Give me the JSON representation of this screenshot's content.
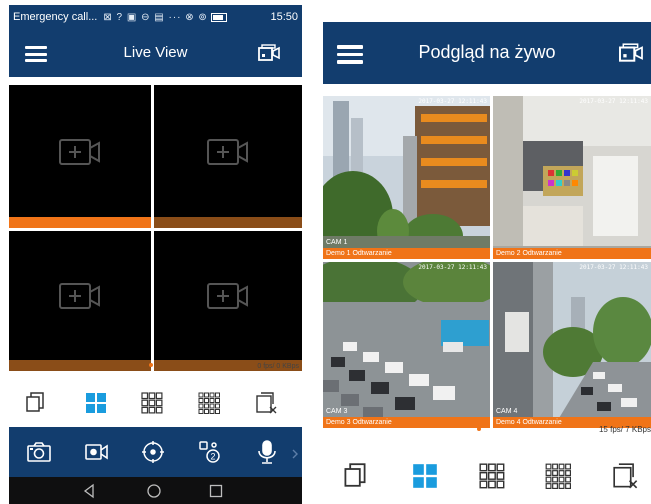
{
  "colors": {
    "appbar": "#123d6e",
    "accent": "#1a9cde",
    "orange": "#f07418",
    "brown": "#8a4d18",
    "tile": "#000000",
    "icon": "#333333"
  },
  "left": {
    "status_bar": {
      "carrier": "Emergency call...",
      "icons": "⊠ ? ▣ ⊖ ▤ ··· ⊗ ⊚",
      "time": "15:50"
    },
    "app_title": "Live View",
    "fps_text": "0 fps/ 0 KBps",
    "layout_icons": [
      "single-view-icon",
      "quad-view-icon",
      "nine-view-icon",
      "sixteen-view-icon",
      "close-all-icon"
    ],
    "selected_layout": "quad-view-icon",
    "tools": [
      "camera-icon",
      "record-icon",
      "ptz-icon",
      "zoom-icon",
      "microphone-icon"
    ],
    "nav": [
      "back-icon",
      "home-icon",
      "recents-icon"
    ]
  },
  "right": {
    "app_title": "Podgląd na żywo",
    "fps_text": "15 fps/ 7 KBps",
    "cams": [
      {
        "timestamp": "2017-03-27 12:11:43",
        "name": "CAM 1",
        "status": "Demo 1  Odtwarzanie"
      },
      {
        "timestamp": "2017-03-27 12:11:43",
        "name": "",
        "status": "Demo 2  Odtwarzanie"
      },
      {
        "timestamp": "2017-03-27 12:11:43",
        "name": "CAM 3",
        "status": "Demo 3  Odtwarzanie"
      },
      {
        "timestamp": "2017-03-27 12:11:43",
        "name": "CAM 4",
        "status": "Demo 4  Odtwarzanie"
      }
    ],
    "selected_layout": "quad-view-icon"
  }
}
